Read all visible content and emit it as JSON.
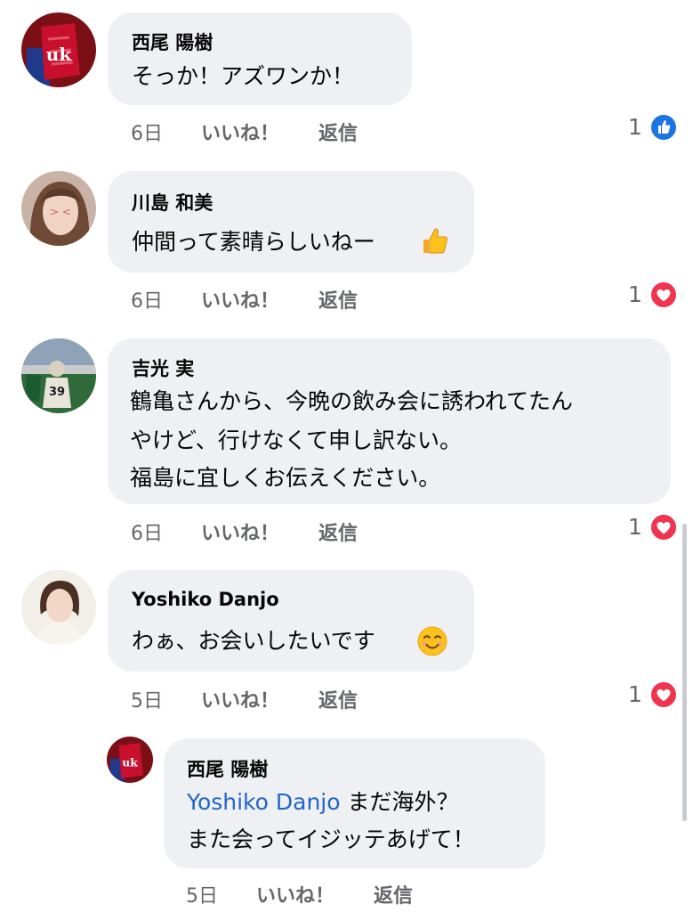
{
  "comments": [
    {
      "author": "西尾 陽樹",
      "line1": "そっか！アズワンか！",
      "time": "6日",
      "like_label": "いいね！",
      "reply_label": "返信",
      "reaction_count": "1",
      "reaction_icon": "like-icon",
      "reaction_color": "#1b74e4"
    },
    {
      "author": "川島 和美",
      "line1": "仲間って素晴らしいねー",
      "emoji": "thumbs-up-emoji",
      "time": "6日",
      "like_label": "いいね！",
      "reply_label": "返信",
      "reaction_count": "1",
      "reaction_icon": "love-icon",
      "reaction_color": "#f0334f"
    },
    {
      "author": "吉光 実",
      "line1": "鶴亀さんから、今晩の飲み会に誘われてたん",
      "line2": "やけど、行けなくて申し訳ない。",
      "line3": "福島に宜しくお伝えください。",
      "time": "6日",
      "like_label": "いいね！",
      "reply_label": "返信",
      "reaction_count": "1",
      "reaction_icon": "love-icon",
      "reaction_color": "#f0334f"
    },
    {
      "author": "Yoshiko Danjo",
      "line1": "わぁ、お会いしたいです",
      "emoji": "smiling-face-emoji",
      "time": "5日",
      "like_label": "いいね！",
      "reply_label": "返信",
      "reaction_count": "1",
      "reaction_icon": "love-icon",
      "reaction_color": "#f0334f"
    }
  ],
  "reply": {
    "author": "西尾 陽樹",
    "mention": "Yoshiko Danjo",
    "line1_rest": " まだ海外？",
    "line2": "また会ってイジッテあげて！",
    "time": "5日",
    "like_label": "いいね！",
    "reply_label": "返信"
  },
  "colors": {
    "bubble": "#eff0f3",
    "meta_text": "#65676b",
    "mention": "#2166c7"
  }
}
